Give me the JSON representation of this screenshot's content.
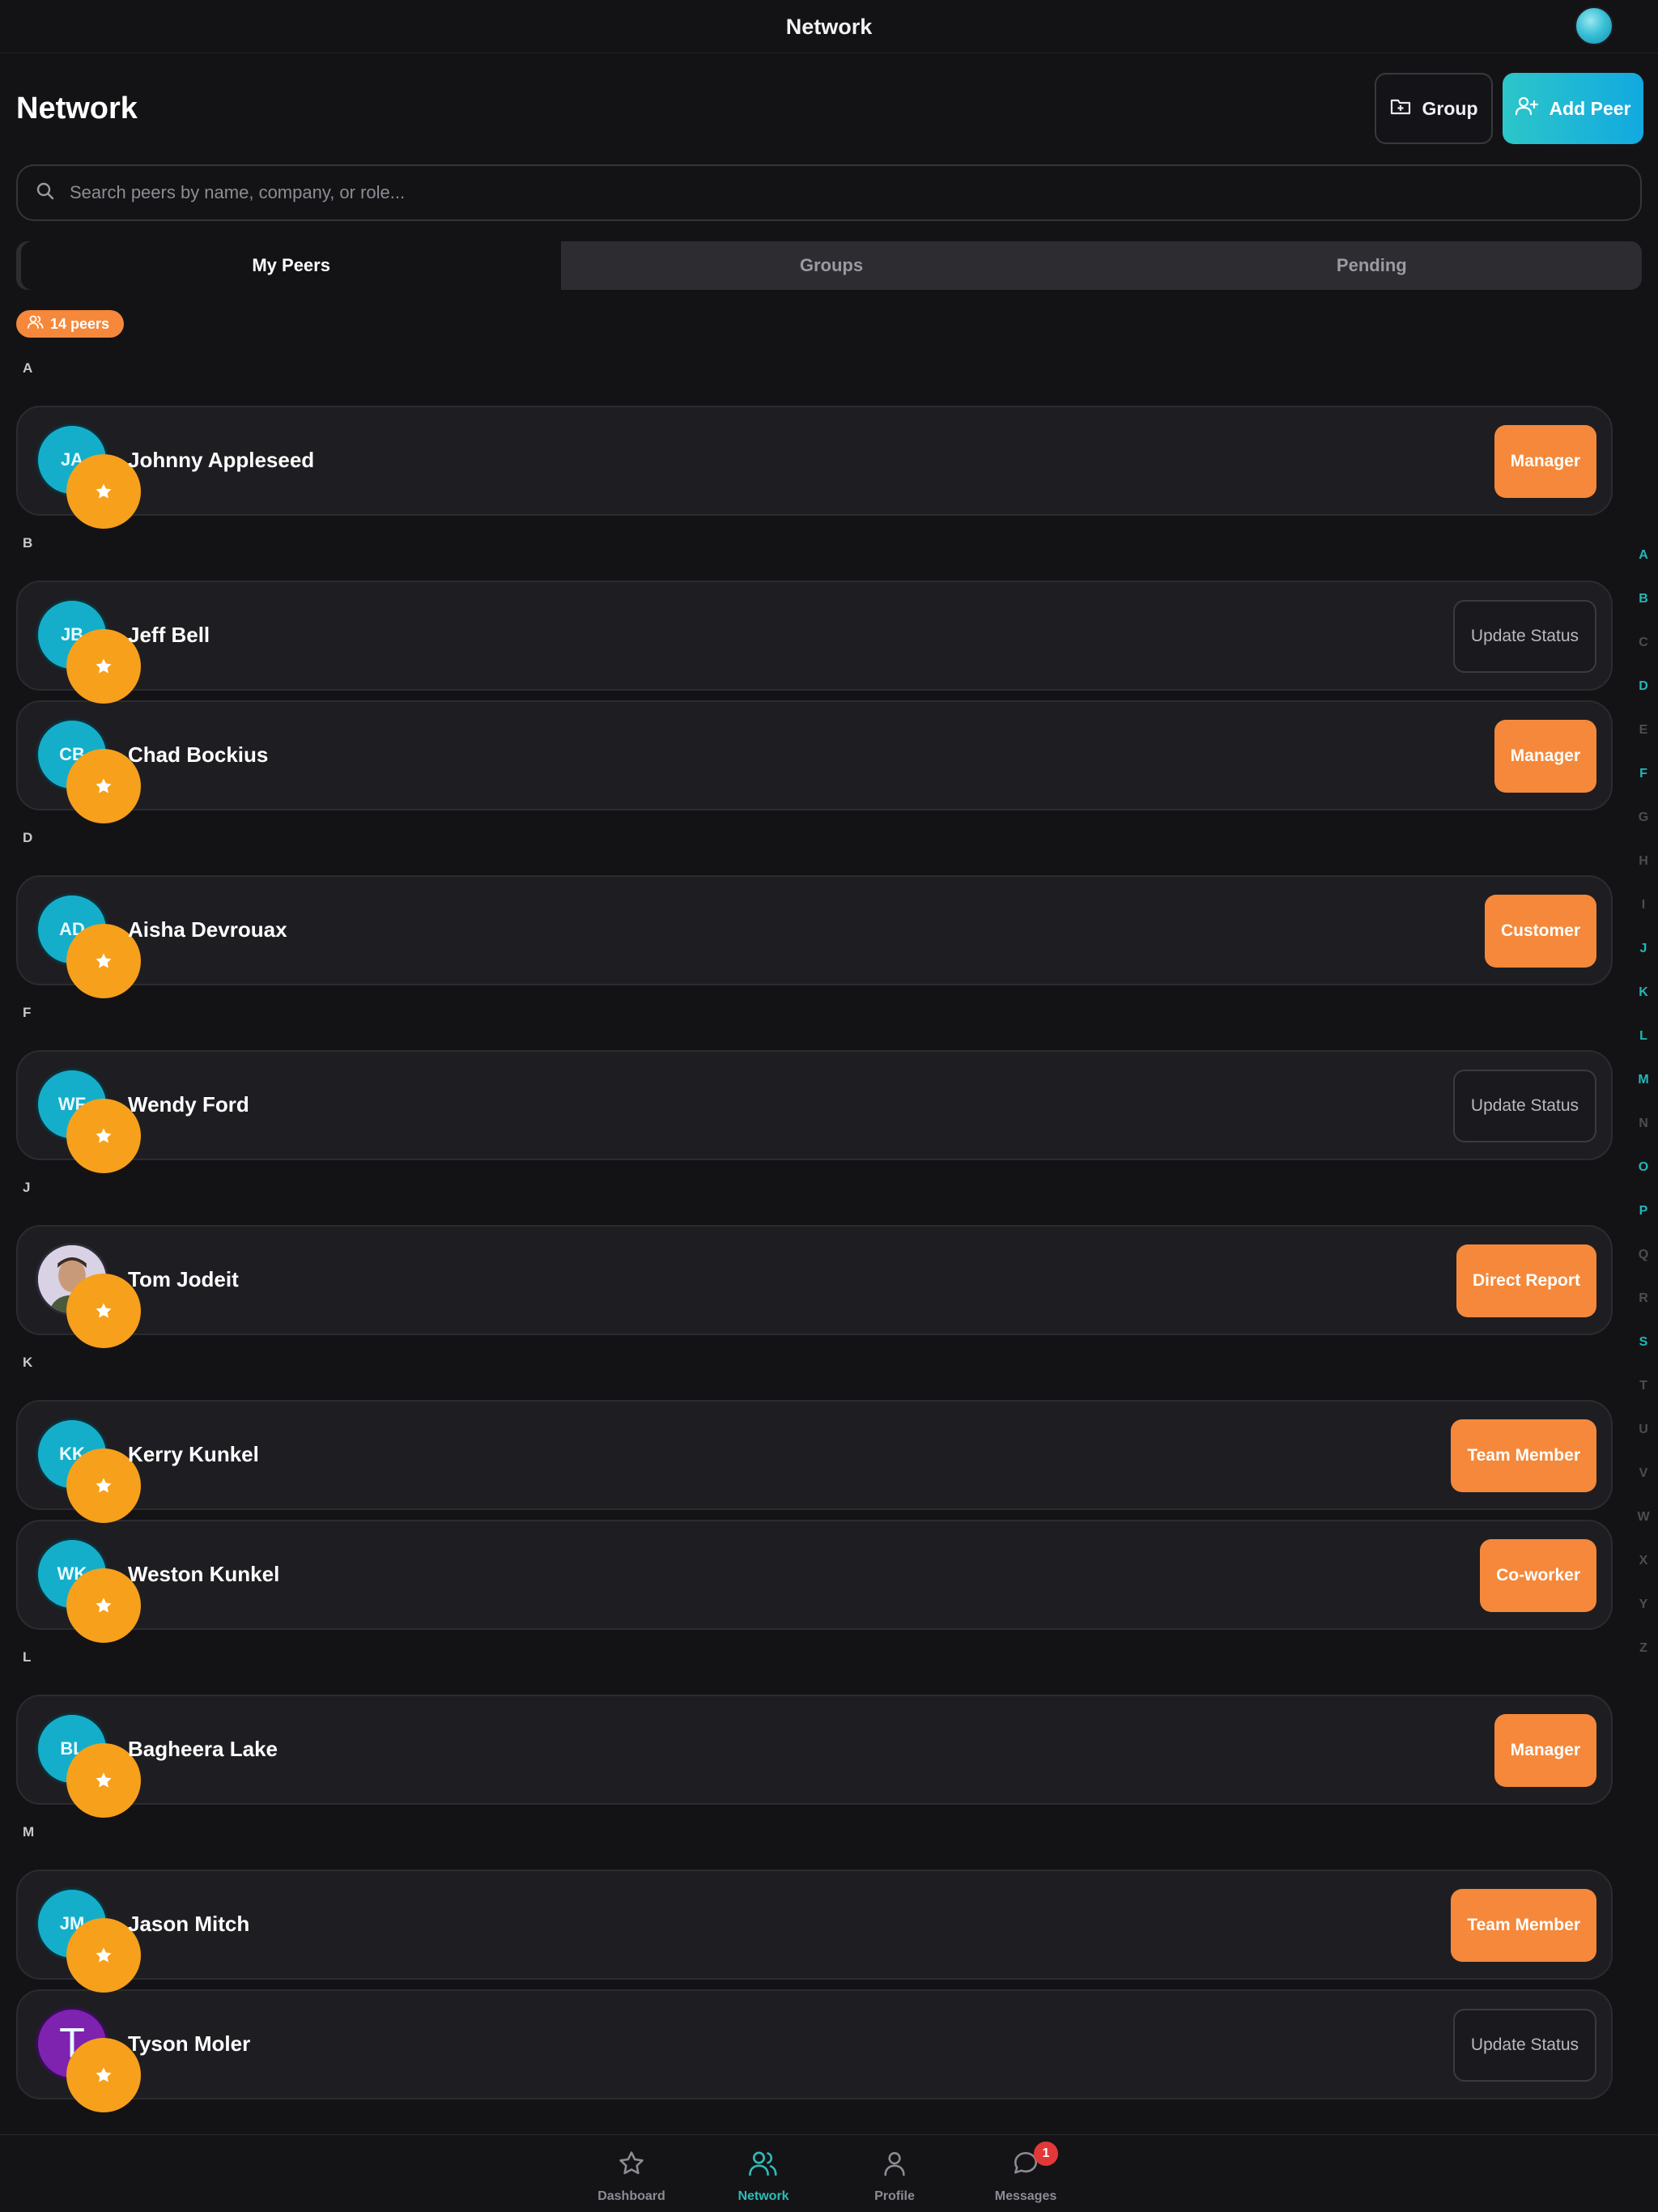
{
  "topbar": {
    "title": "Network"
  },
  "header": {
    "title": "Network",
    "group_label": "Group",
    "add_peer_label": "Add Peer"
  },
  "search": {
    "placeholder": "Search peers by name, company, or role..."
  },
  "tabs": [
    {
      "label": "My Peers",
      "active": true
    },
    {
      "label": "Groups",
      "active": false
    },
    {
      "label": "Pending",
      "active": false
    }
  ],
  "count_badge": "14 peers",
  "sections": [
    {
      "letter": "A",
      "peers": [
        {
          "initials": "JA",
          "name": "Johnny Appleseed",
          "action": "Manager",
          "style": "orange"
        }
      ]
    },
    {
      "letter": "B",
      "peers": [
        {
          "initials": "JB",
          "name": "Jeff Bell",
          "action": "Update Status",
          "style": "ghost"
        },
        {
          "initials": "CB",
          "name": "Chad Bockius",
          "action": "Manager",
          "style": "orange"
        }
      ]
    },
    {
      "letter": "D",
      "peers": [
        {
          "initials": "AD",
          "name": "Aisha Devrouax",
          "action": "Customer",
          "style": "orange"
        }
      ]
    },
    {
      "letter": "F",
      "peers": [
        {
          "initials": "WF",
          "name": "Wendy Ford",
          "action": "Update Status",
          "style": "ghost"
        }
      ]
    },
    {
      "letter": "J",
      "peers": [
        {
          "initials": "",
          "name": "Tom Jodeit",
          "action": "Direct Report",
          "style": "orange",
          "photo": true
        }
      ]
    },
    {
      "letter": "K",
      "peers": [
        {
          "initials": "KK",
          "name": "Kerry Kunkel",
          "action": "Team Member",
          "style": "orange"
        },
        {
          "initials": "WK",
          "name": "Weston Kunkel",
          "action": "Co-worker",
          "style": "orange"
        }
      ]
    },
    {
      "letter": "L",
      "peers": [
        {
          "initials": "BL",
          "name": "Bagheera Lake",
          "action": "Manager",
          "style": "orange"
        }
      ]
    },
    {
      "letter": "M",
      "peers": [
        {
          "initials": "JM",
          "name": "Jason Mitch",
          "action": "Team Member",
          "style": "orange"
        },
        {
          "initials": "T",
          "name": "Tyson Moler",
          "action": "Update Status",
          "style": "ghost",
          "purple": true
        }
      ]
    }
  ],
  "alphabet": [
    {
      "l": "A",
      "on": true
    },
    {
      "l": "B",
      "on": true
    },
    {
      "l": "C",
      "on": false
    },
    {
      "l": "D",
      "on": true
    },
    {
      "l": "E",
      "on": false
    },
    {
      "l": "F",
      "on": true
    },
    {
      "l": "G",
      "on": false
    },
    {
      "l": "H",
      "on": false
    },
    {
      "l": "I",
      "on": false
    },
    {
      "l": "J",
      "on": true
    },
    {
      "l": "K",
      "on": true
    },
    {
      "l": "L",
      "on": true
    },
    {
      "l": "M",
      "on": true
    },
    {
      "l": "N",
      "on": false
    },
    {
      "l": "O",
      "on": true
    },
    {
      "l": "P",
      "on": true
    },
    {
      "l": "Q",
      "on": false
    },
    {
      "l": "R",
      "on": false
    },
    {
      "l": "S",
      "on": true
    },
    {
      "l": "T",
      "on": false
    },
    {
      "l": "U",
      "on": false
    },
    {
      "l": "V",
      "on": false
    },
    {
      "l": "W",
      "on": false
    },
    {
      "l": "X",
      "on": false
    },
    {
      "l": "Y",
      "on": false
    },
    {
      "l": "Z",
      "on": false
    }
  ],
  "bottom_nav": [
    {
      "label": "Dashboard",
      "icon": "star-icon",
      "active": false
    },
    {
      "label": "Network",
      "icon": "users-icon",
      "active": true
    },
    {
      "label": "Profile",
      "icon": "person-icon",
      "active": false
    },
    {
      "label": "Messages",
      "icon": "chat-icon",
      "active": false,
      "badge": "1"
    }
  ],
  "colors": {
    "accent": "#2dbdb8",
    "orange": "#f5883a",
    "star": "#f6a01c",
    "avatar": "#14aecb",
    "background": "#131316"
  }
}
